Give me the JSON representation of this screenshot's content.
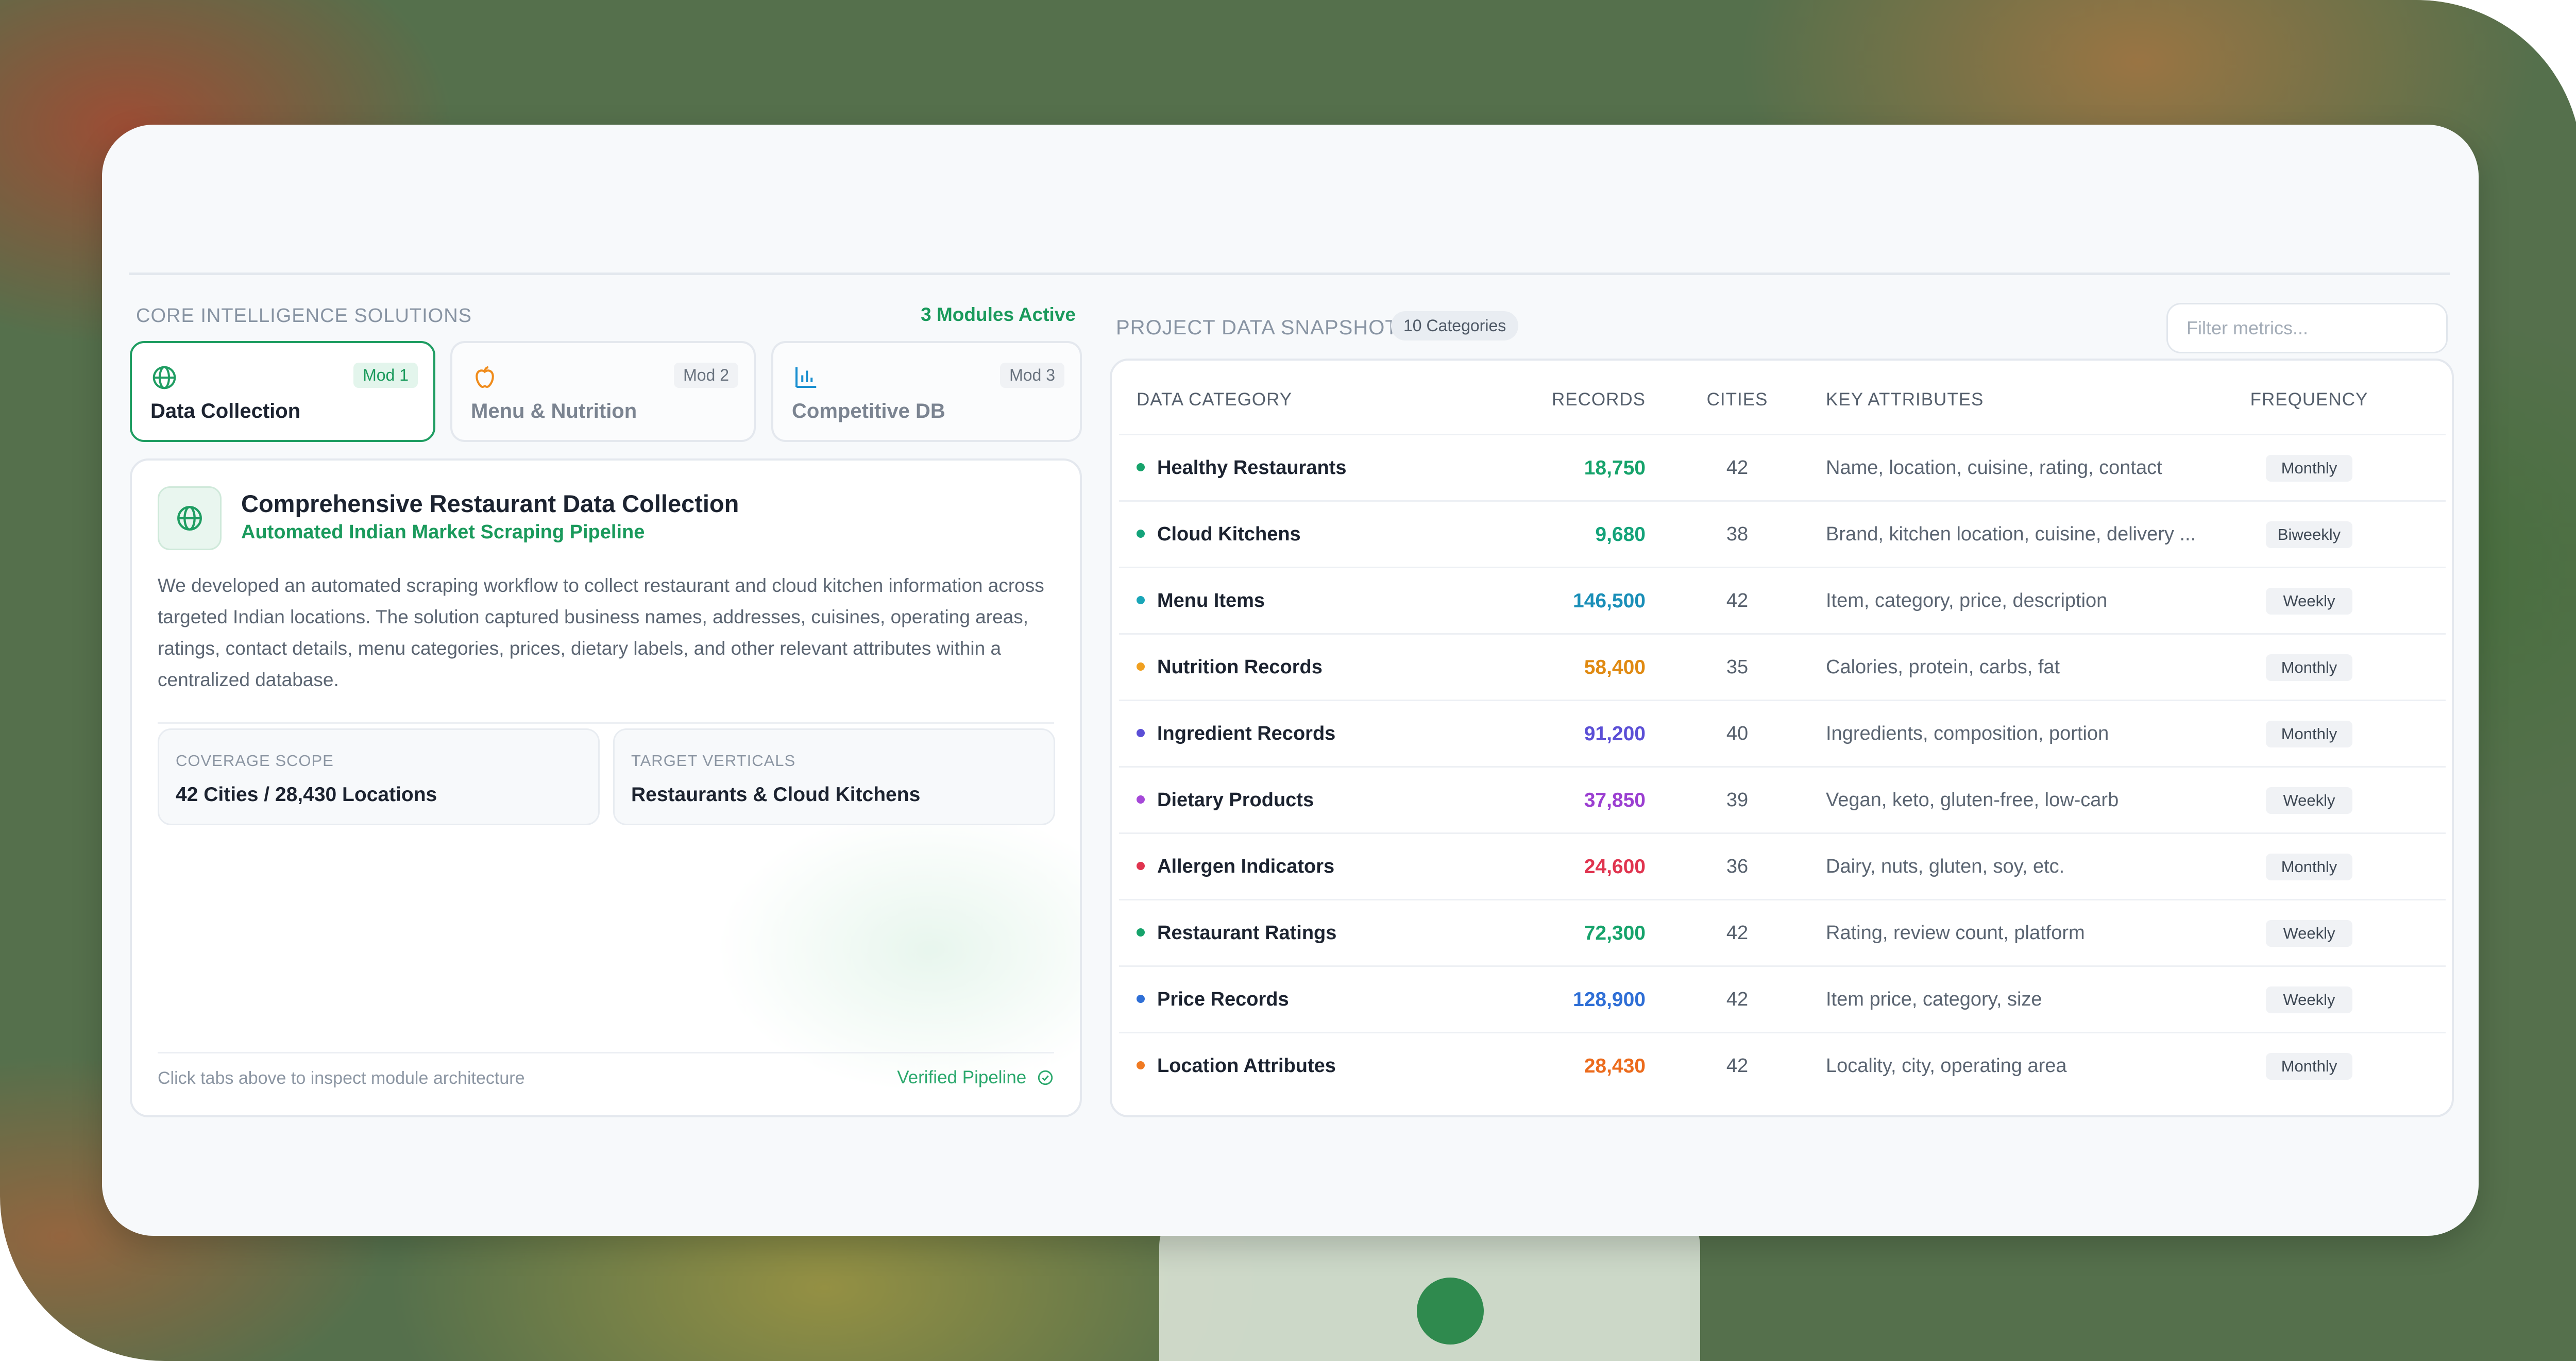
{
  "colors": {
    "accent": "#1f9d62",
    "card_background": "#f7f9fb",
    "records": [
      "#16a36b",
      "#14a37a",
      "#1a8fb8",
      "#e08a12",
      "#5b4fd6",
      "#9b3fd1",
      "#e0344f",
      "#16a36b",
      "#2f6fd6",
      "#ec6b1c"
    ],
    "dots": [
      "#16a36b",
      "#14a37a",
      "#1aa6b8",
      "#f0a020",
      "#5b4fd6",
      "#a548d8",
      "#e0344f",
      "#16a36b",
      "#2f6fd6",
      "#f07a22"
    ]
  },
  "left": {
    "section_title": "CORE INTELLIGENCE SOLUTIONS",
    "modules_badge": "3 Modules Active",
    "tabs": [
      {
        "icon": "globe-icon",
        "label": "Data Collection",
        "mod": "Mod 1",
        "active": true
      },
      {
        "icon": "apple-icon",
        "label": "Menu & Nutrition",
        "mod": "Mod 2",
        "active": false
      },
      {
        "icon": "bar-chart-icon",
        "label": "Competitive DB",
        "mod": "Mod 3",
        "active": false
      }
    ],
    "panel": {
      "icon": "globe-icon",
      "title": "Comprehensive Restaurant Data Collection",
      "subtitle": "Automated Indian Market Scraping Pipeline",
      "description": "We developed an automated scraping workflow to collect restaurant and cloud kitchen information across targeted Indian locations. The solution captured business names, addresses, cuisines, operating areas, ratings, contact details, menu categories, prices, dietary labels, and other relevant attributes within a centralized database.",
      "stats": [
        {
          "label": "COVERAGE SCOPE",
          "value": "42 Cities / 28,430 Locations"
        },
        {
          "label": "TARGET VERTICALS",
          "value": "Restaurants & Cloud Kitchens"
        }
      ],
      "footer_hint": "Click tabs above to inspect module architecture",
      "footer_status": "Verified Pipeline"
    }
  },
  "right": {
    "section_title": "PROJECT DATA SNAPSHOT",
    "categories_badge": "10 Categories",
    "filter_placeholder": "Filter metrics...",
    "columns": {
      "category": "DATA CATEGORY",
      "records": "RECORDS",
      "cities": "CITIES",
      "attributes": "KEY ATTRIBUTES",
      "frequency": "FREQUENCY"
    },
    "rows": [
      {
        "category": "Healthy Restaurants",
        "records": "18,750",
        "cities": "42",
        "attributes": "Name, location, cuisine, rating, contact",
        "frequency": "Monthly"
      },
      {
        "category": "Cloud Kitchens",
        "records": "9,680",
        "cities": "38",
        "attributes": "Brand, kitchen location, cuisine, delivery ...",
        "frequency": "Biweekly"
      },
      {
        "category": "Menu Items",
        "records": "146,500",
        "cities": "42",
        "attributes": "Item, category, price, description",
        "frequency": "Weekly"
      },
      {
        "category": "Nutrition Records",
        "records": "58,400",
        "cities": "35",
        "attributes": "Calories, protein, carbs, fat",
        "frequency": "Monthly"
      },
      {
        "category": "Ingredient Records",
        "records": "91,200",
        "cities": "40",
        "attributes": "Ingredients, composition, portion",
        "frequency": "Monthly"
      },
      {
        "category": "Dietary Products",
        "records": "37,850",
        "cities": "39",
        "attributes": "Vegan, keto, gluten-free, low-carb",
        "frequency": "Weekly"
      },
      {
        "category": "Allergen Indicators",
        "records": "24,600",
        "cities": "36",
        "attributes": "Dairy, nuts, gluten, soy, etc.",
        "frequency": "Monthly"
      },
      {
        "category": "Restaurant Ratings",
        "records": "72,300",
        "cities": "42",
        "attributes": "Rating, review count, platform",
        "frequency": "Weekly"
      },
      {
        "category": "Price Records",
        "records": "128,900",
        "cities": "42",
        "attributes": "Item price, category, size",
        "frequency": "Weekly"
      },
      {
        "category": "Location Attributes",
        "records": "28,430",
        "cities": "42",
        "attributes": "Locality, city, operating area",
        "frequency": "Monthly"
      }
    ]
  }
}
